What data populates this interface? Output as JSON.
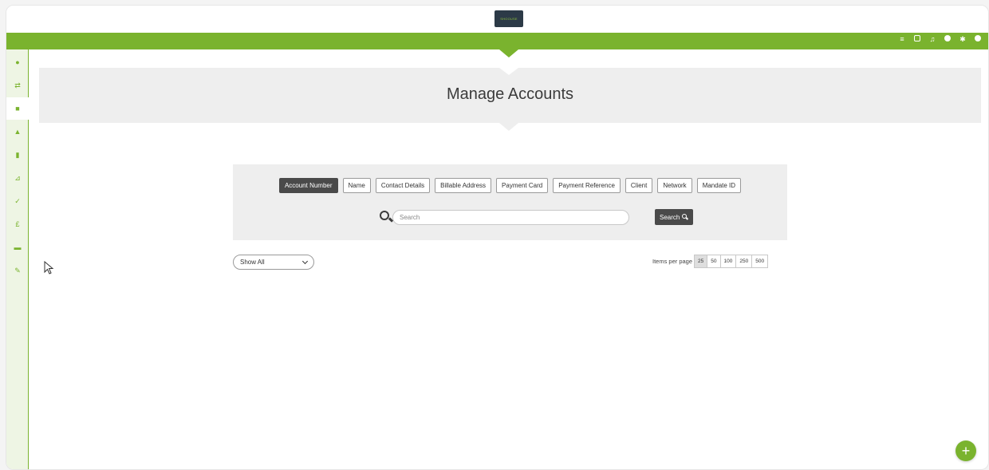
{
  "brand": {
    "logo_text": "SHOOUSE",
    "accent_color": "#7ab32e",
    "dark_button_color": "#4a4a4a"
  },
  "topbar": {
    "icons": [
      "list-icon",
      "note-icon",
      "bell-icon",
      "info-icon",
      "gear-icon",
      "user-icon"
    ]
  },
  "sidebar": {
    "items": [
      {
        "icon": "help-icon",
        "active": false
      },
      {
        "icon": "transfer-icon",
        "active": false
      },
      {
        "icon": "archive-icon",
        "active": true
      },
      {
        "icon": "home-icon",
        "active": false
      },
      {
        "icon": "document-icon",
        "active": false
      },
      {
        "icon": "chart-icon",
        "active": false
      },
      {
        "icon": "check-icon",
        "active": false
      },
      {
        "icon": "pound-icon",
        "active": false
      },
      {
        "icon": "mail-icon",
        "active": false
      },
      {
        "icon": "wrench-icon",
        "active": false
      }
    ]
  },
  "page": {
    "title": "Manage Accounts"
  },
  "search": {
    "filters": [
      {
        "label": "Account Number",
        "active": true
      },
      {
        "label": "Name",
        "active": false
      },
      {
        "label": "Contact Details",
        "active": false
      },
      {
        "label": "Billable Address",
        "active": false
      },
      {
        "label": "Payment Card",
        "active": false
      },
      {
        "label": "Payment Reference",
        "active": false
      },
      {
        "label": "Client",
        "active": false
      },
      {
        "label": "Network",
        "active": false
      },
      {
        "label": "Mandate ID",
        "active": false
      }
    ],
    "placeholder": "Search",
    "value": "",
    "button_label": "Search"
  },
  "listing": {
    "show_filter_value": "Show All",
    "items_per_page_label": "Items per page",
    "items_per_page_options": [
      "25",
      "50",
      "100",
      "250",
      "500"
    ],
    "items_per_page_selected": "25"
  },
  "fab": {
    "label": "+"
  }
}
